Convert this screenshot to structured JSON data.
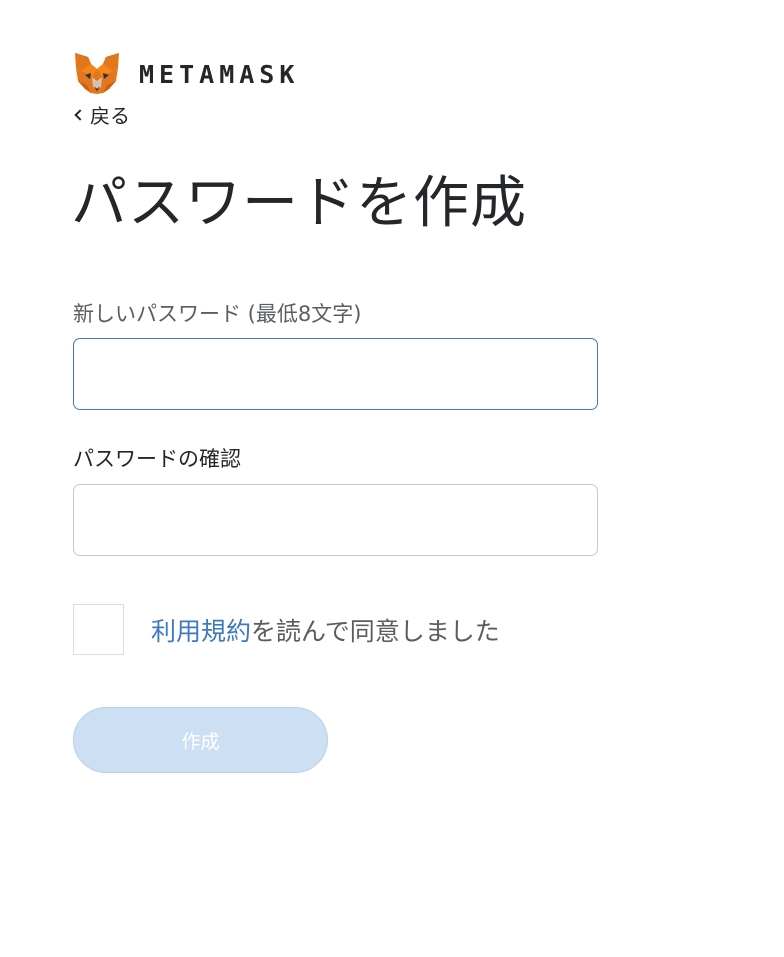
{
  "brand": {
    "wordmark": "METAMASK",
    "logo_icon": "metamask-fox-icon"
  },
  "nav": {
    "back_label": "戻る",
    "back_icon": "chevron-left-icon"
  },
  "page": {
    "title": "パスワードを作成"
  },
  "form": {
    "new_password_label": "新しいパスワード (最低8文字)",
    "new_password_value": "",
    "confirm_password_label": "パスワードの確認",
    "confirm_password_value": "",
    "terms_checked": false,
    "terms_link": "利用規約",
    "terms_suffix": "を読んで同意しました",
    "create_button_label": "作成",
    "create_button_enabled": false
  },
  "colors": {
    "link": "#3f79c0",
    "focus_border": "#3d7bbf",
    "button_disabled_bg": "#cddff3",
    "text_primary": "#24272a",
    "text_secondary": "#5a5e62"
  }
}
